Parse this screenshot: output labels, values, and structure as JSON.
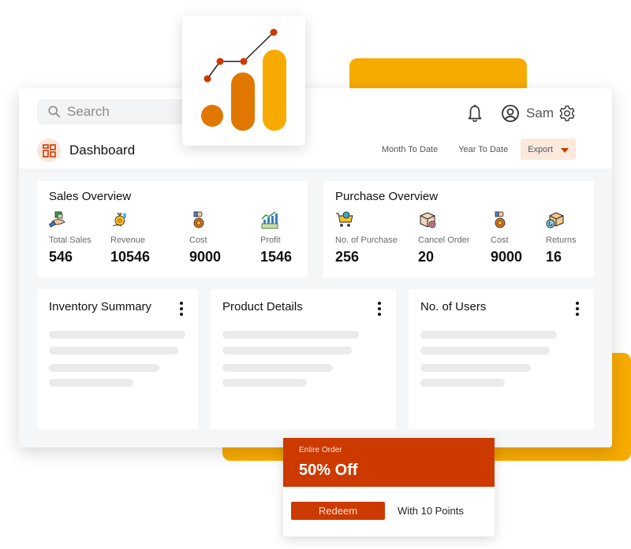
{
  "header": {
    "search_placeholder": "Search",
    "user_name": "Sam",
    "page_title": "Dashboard",
    "icons": {
      "search": "search-icon",
      "notifications": "bell-icon",
      "profile": "user-circle-icon",
      "settings": "gear-icon",
      "dashboard": "grid-layout-icon"
    }
  },
  "filters": {
    "month_to_date": "Month To Date",
    "year_to_date": "Year To Date",
    "export_label": "Export"
  },
  "sales_overview": {
    "title": "Sales Overview",
    "metrics": [
      {
        "label": "Total Sales",
        "value": "546",
        "icon": "hand-money-icon"
      },
      {
        "label": "Revenue",
        "value": "10546",
        "icon": "money-bag-up-icon"
      },
      {
        "label": "Cost",
        "value": "9000",
        "icon": "hand-money-bag-icon"
      },
      {
        "label": "Profit",
        "value": "1546",
        "icon": "profit-chart-icon"
      }
    ]
  },
  "purchase_overview": {
    "title": "Purchase Overview",
    "metrics": [
      {
        "label": "No. of Purchase",
        "value": "256",
        "icon": "shopping-cart-icon"
      },
      {
        "label": "Cancel Order",
        "value": "20",
        "icon": "box-cancel-icon"
      },
      {
        "label": "Cost",
        "value": "9000",
        "icon": "hand-money-bag-icon"
      },
      {
        "label": "Returns",
        "value": "16",
        "icon": "box-return-icon"
      }
    ]
  },
  "panels": [
    {
      "title": "Inventory Summary"
    },
    {
      "title": "Product Details"
    },
    {
      "title": "No. of Users"
    }
  ],
  "promo": {
    "subtitle": "Entire Order",
    "headline": "50% Off",
    "button_label": "Redeem",
    "points_text": "With 10 Points"
  },
  "colors": {
    "brand_red": "#cc3a00",
    "brand_orange": "#e07800",
    "brand_yellow": "#f7ab00",
    "surface_grey": "#f5f6f8"
  }
}
